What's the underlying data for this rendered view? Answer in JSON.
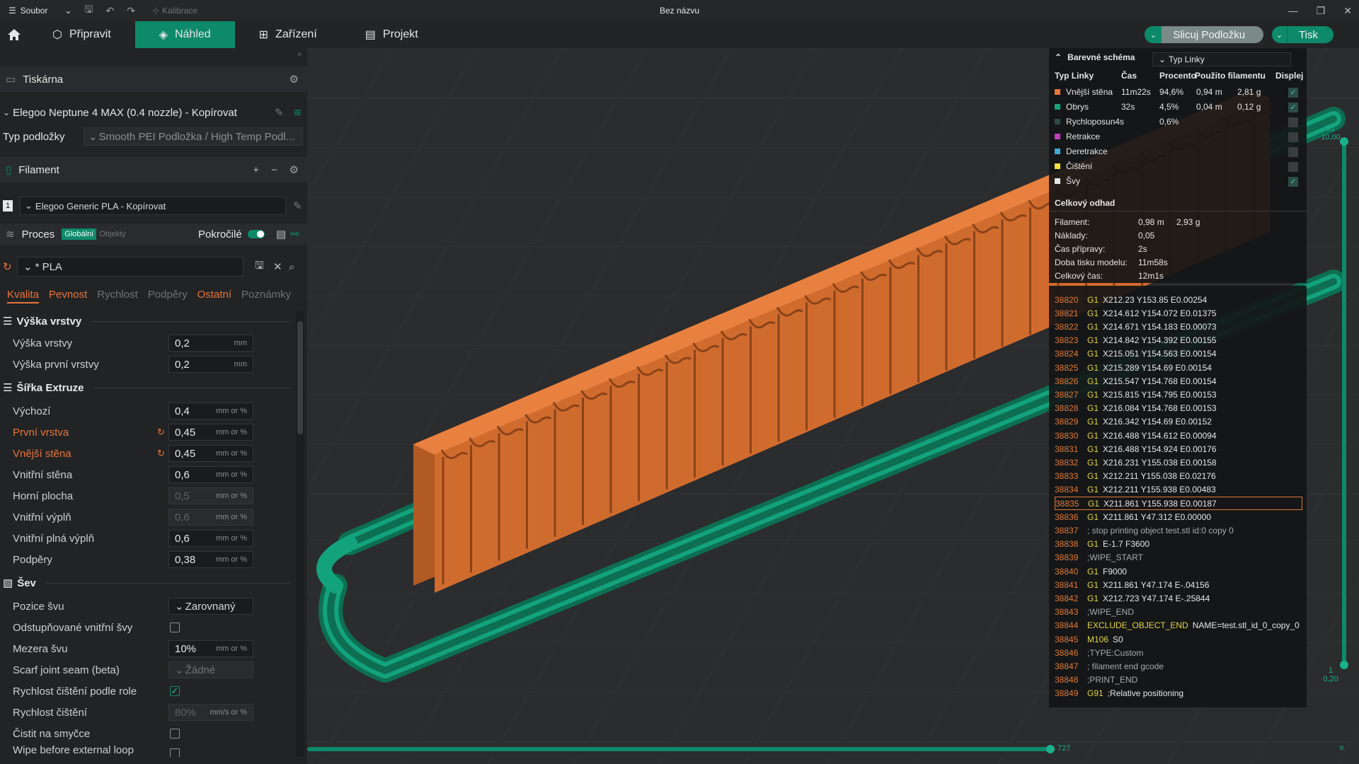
{
  "titlebar": {
    "menu_label": "Soubor",
    "calibrate_label": "Kalibrace",
    "window_title": "Bez názvu"
  },
  "nav": {
    "tabs": [
      {
        "label": "Připravit"
      },
      {
        "label": "Náhled"
      },
      {
        "label": "Zařízení"
      },
      {
        "label": "Projekt"
      }
    ],
    "slice_label": "Slicuj Podložku",
    "print_label": "Tisk"
  },
  "sidebar": {
    "printer_section": "Tiskárna",
    "printer_name": "Elegoo Neptune 4 MAX (0.4 nozzle) - Kopírovat",
    "bed_type_label": "Typ podložky",
    "bed_type_value": "Smooth PEI Podložka / High Temp Podl...",
    "filament_section": "Filament",
    "filament_index": "1",
    "filament_name": "Elegoo Generic PLA - Kopírovat",
    "process_section": "Proces",
    "process_global": "Globální",
    "process_objects": "Objekty",
    "advanced_label": "Pokročilé",
    "preset_name": "* PLA",
    "tabs": [
      "Kvalita",
      "Pevnost",
      "Rychlost",
      "Podpěry",
      "Ostatní",
      "Poznámky"
    ],
    "groups": {
      "layer_height": "Výška vrstvy",
      "extrusion_width": "Šířka Extruze",
      "seam": "Šev"
    },
    "fields": {
      "layer_height": {
        "label": "Výška vrstvy",
        "value": "0,2",
        "unit": "mm"
      },
      "first_layer_height": {
        "label": "Výška první vrstvy",
        "value": "0,2",
        "unit": "mm"
      },
      "default_width": {
        "label": "Výchozí",
        "value": "0,4",
        "unit": "mm or %"
      },
      "first_layer_width": {
        "label": "První vrstva",
        "value": "0,45",
        "unit": "mm or %"
      },
      "outer_wall_width": {
        "label": "Vnější stěna",
        "value": "0,45",
        "unit": "mm or %"
      },
      "inner_wall_width": {
        "label": "Vnitřní stěna",
        "value": "0,6",
        "unit": "mm or %"
      },
      "top_surface_width": {
        "label": "Horní plocha",
        "value": "0,5",
        "unit": "mm or %"
      },
      "sparse_infill_width": {
        "label": "Vnitřní výplň",
        "value": "0,6",
        "unit": "mm or %"
      },
      "solid_infill_width": {
        "label": "Vnitřní plná výplň",
        "value": "0,6",
        "unit": "mm or %"
      },
      "support_width": {
        "label": "Podpěry",
        "value": "0,38",
        "unit": "mm or %"
      },
      "seam_position": {
        "label": "Pozice švu",
        "value": "Zarovnaný"
      },
      "staggered_seams": {
        "label": "Odstupňované vnitřní švy"
      },
      "seam_gap": {
        "label": "Mezera švu",
        "value": "10%",
        "unit": "mm or %"
      },
      "scarf_seam": {
        "label": "Scarf joint seam (beta)",
        "value": "Žádné"
      },
      "role_wipe_speed": {
        "label": "Rychlost čištění podle role"
      },
      "wipe_speed": {
        "label": "Rychlost čištění",
        "value": "80%",
        "unit": "mm/s or %"
      },
      "wipe_on_loop": {
        "label": "Čistit na smyčce"
      },
      "wipe_before_external": {
        "label": "Wipe before external loop"
      }
    }
  },
  "legend": {
    "title": "Barevné schéma",
    "scheme": "Typ Linky",
    "columns": [
      "Typ Linky",
      "Čas",
      "Procento",
      "Použito filamentu",
      "Displej"
    ],
    "rows": [
      {
        "name": "Vnější stěna",
        "time": "11m22s",
        "pct": "94,6%",
        "len": "0,94 m",
        "weight": "2,81 g",
        "color": "#e8753a",
        "on": true
      },
      {
        "name": "Obrys",
        "time": "32s",
        "pct": "4,5%",
        "len": "0,04 m",
        "weight": "0,12 g",
        "color": "#13a37c",
        "on": true
      },
      {
        "name": "Rychloposun4s",
        "time": "",
        "pct": "0,6%",
        "len": "",
        "weight": "",
        "color": "#2f4a46",
        "on": false
      },
      {
        "name": "Retrakce",
        "time": "",
        "pct": "",
        "len": "",
        "weight": "",
        "color": "#c33cc2",
        "on": false
      },
      {
        "name": "Deretrakce",
        "time": "",
        "pct": "",
        "len": "",
        "weight": "",
        "color": "#41a9d9",
        "on": false
      },
      {
        "name": "Čištění",
        "time": "",
        "pct": "",
        "len": "",
        "weight": "",
        "color": "#f0e13c",
        "on": false
      },
      {
        "name": "Švy",
        "time": "",
        "pct": "",
        "len": "",
        "weight": "",
        "color": "#e6e6e6",
        "on": true
      }
    ],
    "estimate_title": "Celkový odhad",
    "estimate": [
      {
        "label": "Filament:",
        "value": "0,98 m",
        "value2": "2,93 g"
      },
      {
        "label": "Náklady:",
        "value": "0,05",
        "value2": ""
      },
      {
        "label": "Čas přípravy:",
        "value": "2s",
        "value2": ""
      },
      {
        "label": "Doba tisku modelu:",
        "value": "11m58s",
        "value2": ""
      },
      {
        "label": "Celkový čas:",
        "value": "12m1s",
        "value2": ""
      }
    ]
  },
  "gcode": [
    {
      "n": "38820",
      "cmd": "G1",
      "args": "X212.23 Y153.85 E0.00254"
    },
    {
      "n": "38821",
      "cmd": "G1",
      "args": "X214.612 Y154.072 E0.01375"
    },
    {
      "n": "38822",
      "cmd": "G1",
      "args": "X214.671 Y154.183 E0.00073"
    },
    {
      "n": "38823",
      "cmd": "G1",
      "args": "X214.842 Y154.392 E0.00155"
    },
    {
      "n": "38824",
      "cmd": "G1",
      "args": "X215.051 Y154.563 E0.00154"
    },
    {
      "n": "38825",
      "cmd": "G1",
      "args": "X215.289 Y154.69 E0.00154"
    },
    {
      "n": "38826",
      "cmd": "G1",
      "args": "X215.547 Y154.768 E0.00154"
    },
    {
      "n": "38827",
      "cmd": "G1",
      "args": "X215.815 Y154.795 E0.00153"
    },
    {
      "n": "38828",
      "cmd": "G1",
      "args": "X216.084 Y154.768 E0.00153"
    },
    {
      "n": "38829",
      "cmd": "G1",
      "args": "X216.342 Y154.69 E0.00152"
    },
    {
      "n": "38830",
      "cmd": "G1",
      "args": "X216.488 Y154.612 E0.00094"
    },
    {
      "n": "38831",
      "cmd": "G1",
      "args": "X216.488 Y154.924 E0.00176"
    },
    {
      "n": "38832",
      "cmd": "G1",
      "args": "X216.231 Y155.038 E0.00158"
    },
    {
      "n": "38833",
      "cmd": "G1",
      "args": "X212.211 Y155.038 E0.02176"
    },
    {
      "n": "38834",
      "cmd": "G1",
      "args": "X212.211 Y155.938 E0.00483"
    },
    {
      "n": "38835",
      "cmd": "G1",
      "args": "X211.861 Y155.938 E0.00187"
    },
    {
      "n": "38836",
      "cmd": "G1",
      "args": "X211.861 Y47.312 E0.00000"
    },
    {
      "n": "38837",
      "cmd": "",
      "args": "; stop printing object test.stl id:0 copy 0"
    },
    {
      "n": "38838",
      "cmd": "G1",
      "args": "E-1.7 F3600"
    },
    {
      "n": "38839",
      "cmd": "",
      "args": ";WIPE_START"
    },
    {
      "n": "38840",
      "cmd": "G1",
      "args": "F9000"
    },
    {
      "n": "38841",
      "cmd": "G1",
      "args": "X211.861 Y47.174 E-.04156"
    },
    {
      "n": "38842",
      "cmd": "G1",
      "args": "X212.723 Y47.174 E-.25844"
    },
    {
      "n": "38843",
      "cmd": "",
      "args": ";WIPE_END"
    },
    {
      "n": "38844",
      "cmd": "EXCLUDE_OBJECT_END",
      "args": "NAME=test.stl_id_0_copy_0"
    },
    {
      "n": "38845",
      "cmd": "M106",
      "args": "S0"
    },
    {
      "n": "38846",
      "cmd": "",
      "args": ";TYPE:Custom"
    },
    {
      "n": "38847",
      "cmd": "",
      "args": "; filament end gcode"
    },
    {
      "n": "38848",
      "cmd": "",
      "args": ";PRINT_END"
    },
    {
      "n": "38849",
      "cmd": "G91",
      "args": ";Relative positioning"
    }
  ],
  "sliders": {
    "layer_top": "51",
    "layer_top_height": "10,00",
    "layer_bottom": "1",
    "layer_bottom_height": "0,20",
    "move_value": "727"
  }
}
